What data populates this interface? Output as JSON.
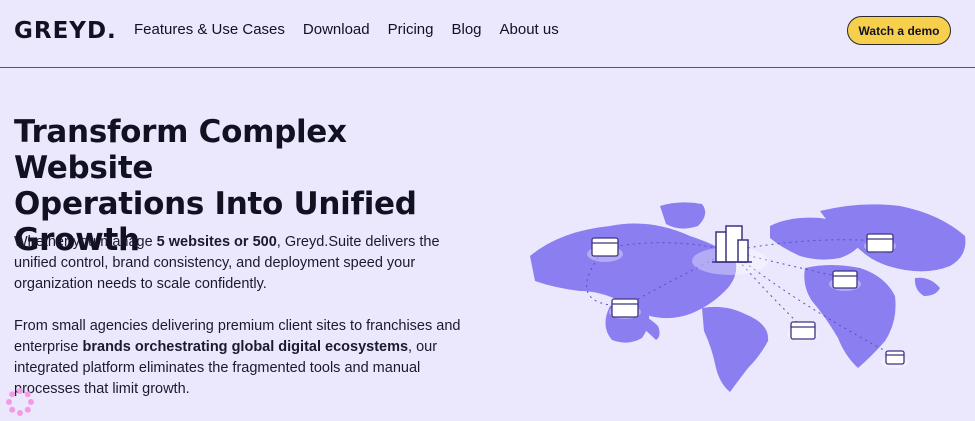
{
  "header": {
    "logo": "GREYD.",
    "nav": [
      "Features & Use Cases",
      "Download",
      "Pricing",
      "Blog",
      "About us"
    ],
    "cta": "Watch a demo"
  },
  "hero": {
    "title_lines": [
      "Transform Complex Website",
      "Operations Into Unified",
      "Growth"
    ],
    "p1": {
      "a": "Whether you manage ",
      "b": "5 websites or 500",
      "c": ", Greyd.Suite delivers the unified control, brand consistency, and deployment speed your organization needs to scale confidently."
    },
    "p2": {
      "a": "From small agencies delivering premium client sites to franchises and enterprise ",
      "b": "brands orchestrating global digital ecosystems",
      "c": ", our integrated platform eliminates the fragmented tools and manual processes that limit growth."
    }
  },
  "colors": {
    "background": "#ebe8fd",
    "map": "#8a7ef0",
    "button": "#f6d04d"
  }
}
